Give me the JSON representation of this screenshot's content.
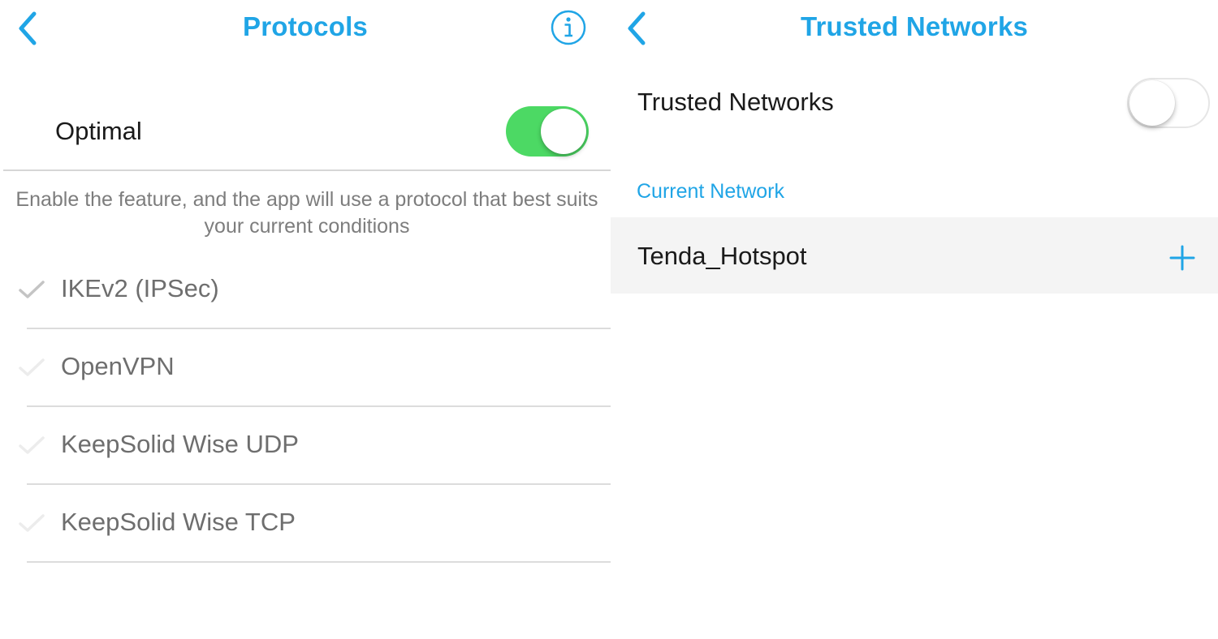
{
  "protocols_screen": {
    "title": "Protocols",
    "optimal": {
      "label": "Optimal",
      "enabled": true
    },
    "description": "Enable the feature, and the app will use a protocol that best suits your current conditions",
    "protocols": [
      {
        "name": "IKEv2 (IPSec)",
        "checked": true
      },
      {
        "name": "OpenVPN",
        "checked": false
      },
      {
        "name": "KeepSolid Wise UDP",
        "checked": false
      },
      {
        "name": "KeepSolid Wise TCP",
        "checked": false
      }
    ]
  },
  "trusted_screen": {
    "title": "Trusted Networks",
    "toggle": {
      "label": "Trusted Networks",
      "enabled": false
    },
    "section_header": "Current Network",
    "network": {
      "name": "Tenda_Hotspot"
    }
  },
  "colors": {
    "accent": "#20a5e6",
    "toggle_on": "#4cd964",
    "check_active": "#c4c4c4",
    "check_inactive": "#ececec"
  },
  "icons": {
    "back": "chevron-left-icon",
    "info": "info-circle-icon",
    "check": "checkmark-icon",
    "add": "plus-icon"
  }
}
